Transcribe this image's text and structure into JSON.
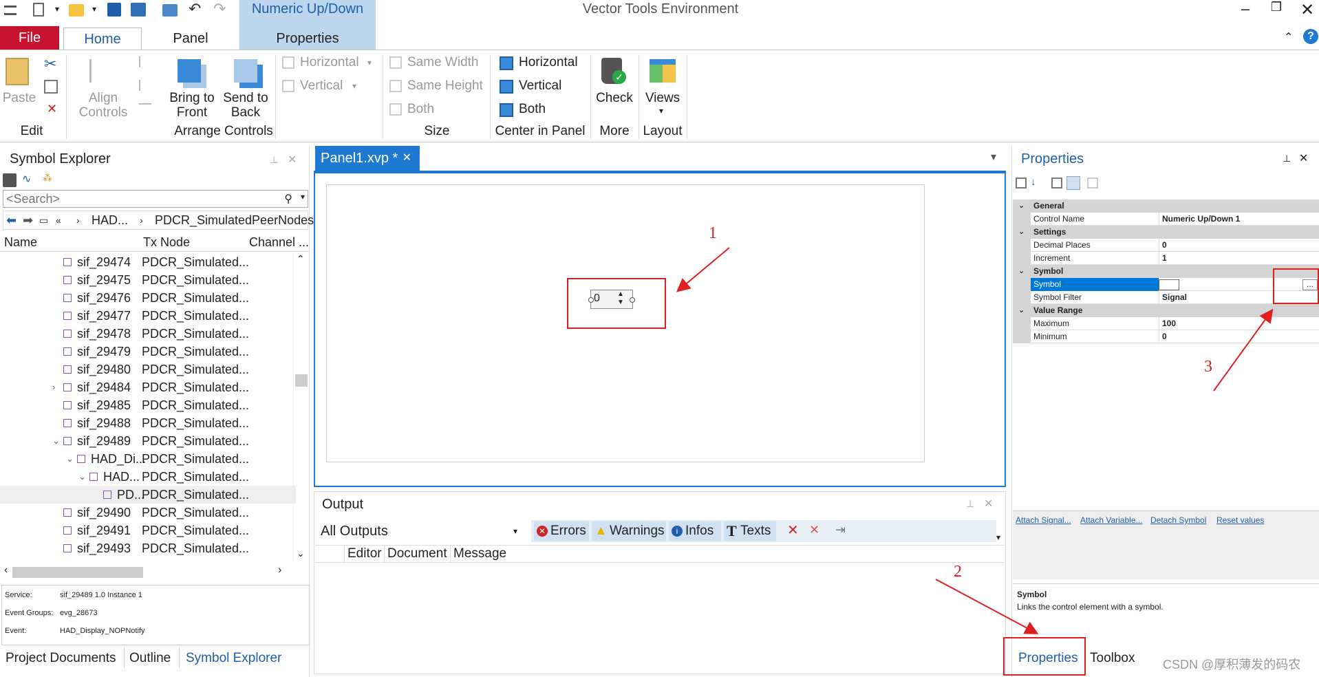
{
  "title_bar": {
    "context_tab": "Numeric Up/Down",
    "app_title": "Vector Tools Environment"
  },
  "ribbon_tabs": {
    "file": "File",
    "home": "Home",
    "panel": "Panel",
    "properties": "Properties"
  },
  "ribbon": {
    "paste": "Paste",
    "align_controls_1": "Align",
    "align_controls_2": "Controls",
    "bring_front_1": "Bring to",
    "bring_front_2": "Front",
    "send_back_1": "Send to",
    "send_back_2": "Back",
    "space_horizontal": "Horizontal",
    "space_vertical": "Vertical",
    "same_width": "Same Width",
    "same_height": "Same Height",
    "both_size": "Both",
    "center_horizontal": "Horizontal",
    "center_vertical": "Vertical",
    "center_both": "Both",
    "check": "Check",
    "views": "Views",
    "groups": {
      "edit": "Edit",
      "arrange": "Arrange Controls",
      "size": "Size",
      "center": "Center in Panel",
      "more": "More",
      "layout": "Layout"
    }
  },
  "symbol_explorer": {
    "title": "Symbol Explorer",
    "search_placeholder": "<Search>",
    "breadcrumb_1": "HAD...",
    "breadcrumb_2": "PDCR_SimulatedPeerNodes",
    "columns": [
      "Name",
      "Tx Node",
      "Channel ..."
    ],
    "rows": [
      {
        "name": "sif_29474",
        "tx": "PDCR_Simulated..."
      },
      {
        "name": "sif_29475",
        "tx": "PDCR_Simulated..."
      },
      {
        "name": "sif_29476",
        "tx": "PDCR_Simulated..."
      },
      {
        "name": "sif_29477",
        "tx": "PDCR_Simulated..."
      },
      {
        "name": "sif_29478",
        "tx": "PDCR_Simulated..."
      },
      {
        "name": "sif_29479",
        "tx": "PDCR_Simulated..."
      },
      {
        "name": "sif_29480",
        "tx": "PDCR_Simulated..."
      },
      {
        "name": "sif_29484",
        "tx": "PDCR_Simulated..."
      },
      {
        "name": "sif_29485",
        "tx": "PDCR_Simulated..."
      },
      {
        "name": "sif_29488",
        "tx": "PDCR_Simulated..."
      },
      {
        "name": "sif_29489",
        "tx": "PDCR_Simulated..."
      },
      {
        "name": "HAD_Di...",
        "tx": "PDCR_Simulated..."
      },
      {
        "name": "HAD...",
        "tx": "PDCR_Simulated..."
      },
      {
        "name": "PD...",
        "tx": "PDCR_Simulated..."
      },
      {
        "name": "sif_29490",
        "tx": "PDCR_Simulated..."
      },
      {
        "name": "sif_29491",
        "tx": "PDCR_Simulated..."
      },
      {
        "name": "sif_29493",
        "tx": "PDCR_Simulated..."
      }
    ],
    "info": {
      "service_label": "Service:",
      "service_value": "sif_29489 1.0 Instance 1",
      "groups_label": "Event Groups:",
      "groups_value": "evg_28673",
      "event_label": "Event:",
      "event_value": "HAD_Display_NOPNotify"
    },
    "bottom_tabs": [
      "Project Documents",
      "Outline",
      "Symbol Explorer"
    ]
  },
  "document": {
    "tab_label": "Panel1.xvp *",
    "numeric_value": "0"
  },
  "output": {
    "title": "Output",
    "source": "All Outputs",
    "filters": {
      "errors": "Errors",
      "warnings": "Warnings",
      "infos": "Infos",
      "texts": "Texts"
    },
    "columns": [
      "Editor",
      "Document",
      "Message"
    ]
  },
  "properties": {
    "title": "Properties",
    "rows": [
      {
        "category": "General"
      },
      {
        "key": "Control Name",
        "value": "Numeric Up/Down 1"
      },
      {
        "category": "Settings"
      },
      {
        "key": "Decimal Places",
        "value": "0"
      },
      {
        "key": "Increment",
        "value": "1"
      },
      {
        "category": "Symbol"
      },
      {
        "key": "Symbol",
        "value": ""
      },
      {
        "key": "Symbol Filter",
        "value": "Signal"
      },
      {
        "category": "Value Range"
      },
      {
        "key": "Maximum",
        "value": "100"
      },
      {
        "key": "Minimum",
        "value": "0"
      }
    ],
    "browse_button": "...",
    "links": {
      "attach_signal": "Attach Signal...",
      "attach_variable": "Attach Variable...",
      "detach_symbol": "Detach Symbol",
      "reset_values": "Reset values"
    },
    "desc_title": "Symbol",
    "desc_text": "Links the control element with a symbol.",
    "bottom_tabs": [
      "Properties",
      "Toolbox"
    ]
  },
  "annotations": [
    "1",
    "2",
    "3"
  ],
  "watermark": "CSDN @厚积薄发的码农",
  "colors": {
    "accent": "#1f5ea8",
    "file_tab": "#c4122f",
    "annotation": "#e02020",
    "selection": "#0078d7"
  }
}
